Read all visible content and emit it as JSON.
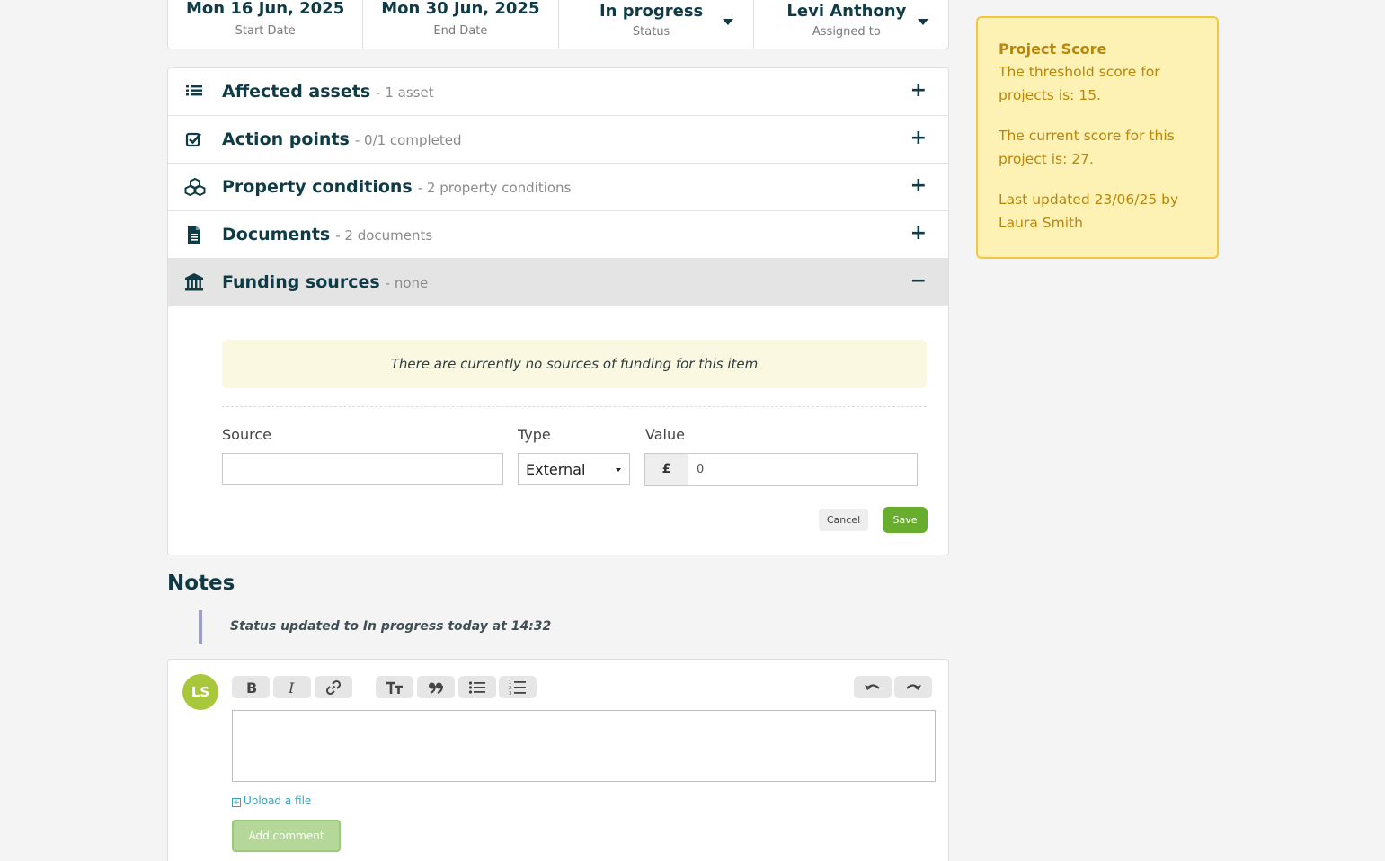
{
  "summary": {
    "start_date": {
      "value": "Mon 16 Jun, 2025",
      "label": "Start Date"
    },
    "end_date": {
      "value": "Mon 30 Jun, 2025",
      "label": "End Date"
    },
    "status": {
      "value": "In progress",
      "label": "Status"
    },
    "assigned": {
      "value": "Levi Anthony",
      "label": "Assigned to"
    }
  },
  "sections": [
    {
      "title": "Affected assets",
      "sub": "- 1 asset",
      "toggle": "+",
      "icon": "list-icon"
    },
    {
      "title": "Action points",
      "sub": "- 0/1 completed",
      "toggle": "+",
      "icon": "checkbox-icon"
    },
    {
      "title": "Property conditions",
      "sub": "- 2 property conditions",
      "toggle": "+",
      "icon": "cubes-icon"
    },
    {
      "title": "Documents",
      "sub": "- 2 documents",
      "toggle": "+",
      "icon": "document-icon"
    },
    {
      "title": "Funding sources",
      "sub": "- none",
      "toggle": "−",
      "icon": "bank-icon",
      "open": true
    }
  ],
  "funding": {
    "empty_message": "There are currently no sources of funding for this item",
    "source_label": "Source",
    "source_value": "",
    "type_label": "Type",
    "type_value": "External",
    "value_label": "Value",
    "currency": "£",
    "value": "0",
    "cancel": "Cancel",
    "save": "Save"
  },
  "score": {
    "title": "Project Score",
    "threshold": "The threshold score for projects is: 15.",
    "current": "The current score for this project is: 27.",
    "updated": "Last updated 23/06/25 by Laura Smith"
  },
  "notes": {
    "title": "Notes",
    "items": [
      "Status updated to In progress today at 14:32"
    ],
    "avatar_initials": "LS",
    "upload": "Upload a file",
    "add_comment": "Add comment"
  },
  "colors": {
    "primary": "#0f3b47",
    "save_green": "#69ad2e",
    "score_bg": "#fef1b4",
    "score_border": "#f2c744",
    "score_text": "#b8860b",
    "avatar": "#a8c73a",
    "note_bar": "#9c9dcc"
  }
}
